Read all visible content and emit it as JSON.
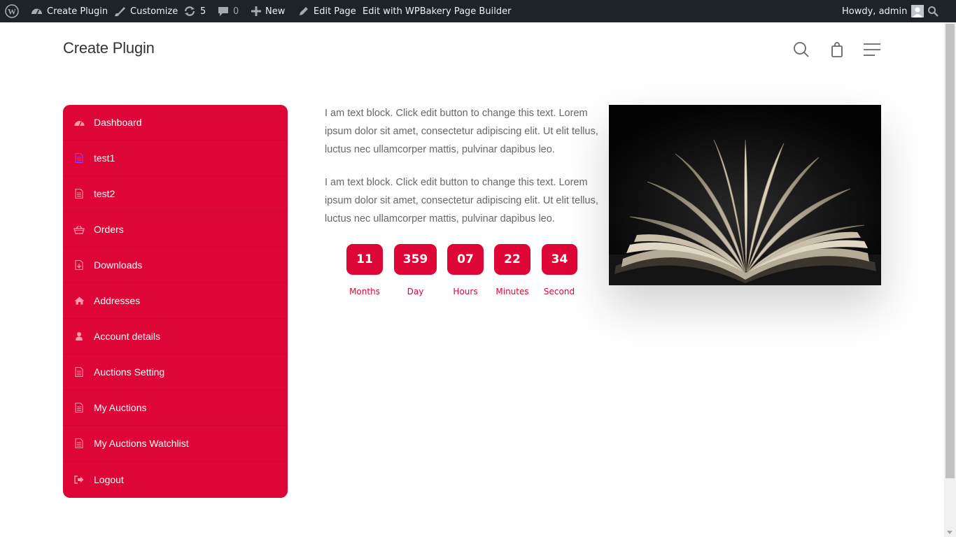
{
  "admin_bar": {
    "site_name": "Create Plugin",
    "customize": "Customize",
    "updates_count": "5",
    "comments_count": "0",
    "new": "New",
    "edit_page": "Edit Page",
    "edit_builder": "Edit with WPBakery Page Builder",
    "howdy": "Howdy, admin"
  },
  "header": {
    "site_title": "Create Plugin"
  },
  "nav": {
    "items": [
      {
        "label": "Dashboard",
        "icon": "dashboard-icon"
      },
      {
        "label": "test1",
        "icon": "document-icon"
      },
      {
        "label": "test2",
        "icon": "document-icon"
      },
      {
        "label": "Orders",
        "icon": "basket-icon"
      },
      {
        "label": "Downloads",
        "icon": "download-file-icon"
      },
      {
        "label": "Addresses",
        "icon": "home-icon"
      },
      {
        "label": "Account details",
        "icon": "user-icon"
      },
      {
        "label": "Auctions Setting",
        "icon": "document-icon"
      },
      {
        "label": "My Auctions",
        "icon": "document-icon"
      },
      {
        "label": "My Auctions Watchlist",
        "icon": "document-icon"
      },
      {
        "label": "Logout",
        "icon": "logout-icon"
      }
    ]
  },
  "content": {
    "paragraph1": "I am text block. Click edit button to change this text. Lorem ipsum dolor sit amet, consectetur adipiscing elit. Ut elit tellus, luctus nec ullamcorper mattis, pulvinar dapibus leo.",
    "paragraph2": "I am text block. Click edit button to change this text. Lorem ipsum dolor sit amet, consectetur adipiscing elit. Ut elit tellus, luctus nec ullamcorper mattis, pulvinar dapibus leo."
  },
  "countdown": {
    "months": {
      "value": "11",
      "label": "Months"
    },
    "day": {
      "value": "359",
      "label": "Day"
    },
    "hours": {
      "value": "07",
      "label": "Hours"
    },
    "minutes": {
      "value": "22",
      "label": "Minutes"
    },
    "second": {
      "value": "34",
      "label": "Second"
    }
  },
  "colors": {
    "accent": "#de0537",
    "admin_bar": "#1d2327"
  }
}
